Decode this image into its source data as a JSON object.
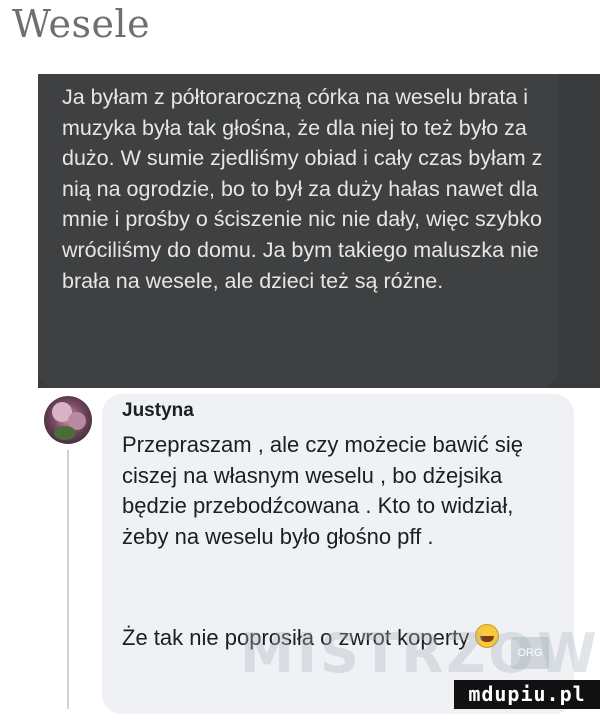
{
  "page_title": "Wesele",
  "post": {
    "text": "Ja byłam z półtoraroczną córka na weselu brata i muzyka była tak głośna, że dla niej to też było za dużo. W sumie zjedliśmy obiad i cały czas byłam z nią na ogrodzie, bo to był za duży hałas nawet dla mnie i prośby o ściszenie nic nie dały, więc szybko wróciliśmy do domu. Ja bym takiego maluszka nie brała na wesele, ale dzieci też są różne."
  },
  "comment": {
    "author": "Justyna",
    "text": "Przepraszam , ale czy możecie bawić się ciszej na własnym weselu , bo dżejsika będzie przebodźcowana . Kto to widział, żeby na weselu było głośno pff .",
    "text2": "Że tak nie poprosiła o zwrot koperty",
    "emoji": "grinning-sweat-emoji"
  },
  "watermark": {
    "text": "MISTRZOWIE",
    "badge": "ORG"
  },
  "site_logo": "mdupiu.pl",
  "colors": {
    "dark_bubble": "#3e4042",
    "light_bubble": "#eff1f4",
    "title": "#6f6f6f"
  }
}
